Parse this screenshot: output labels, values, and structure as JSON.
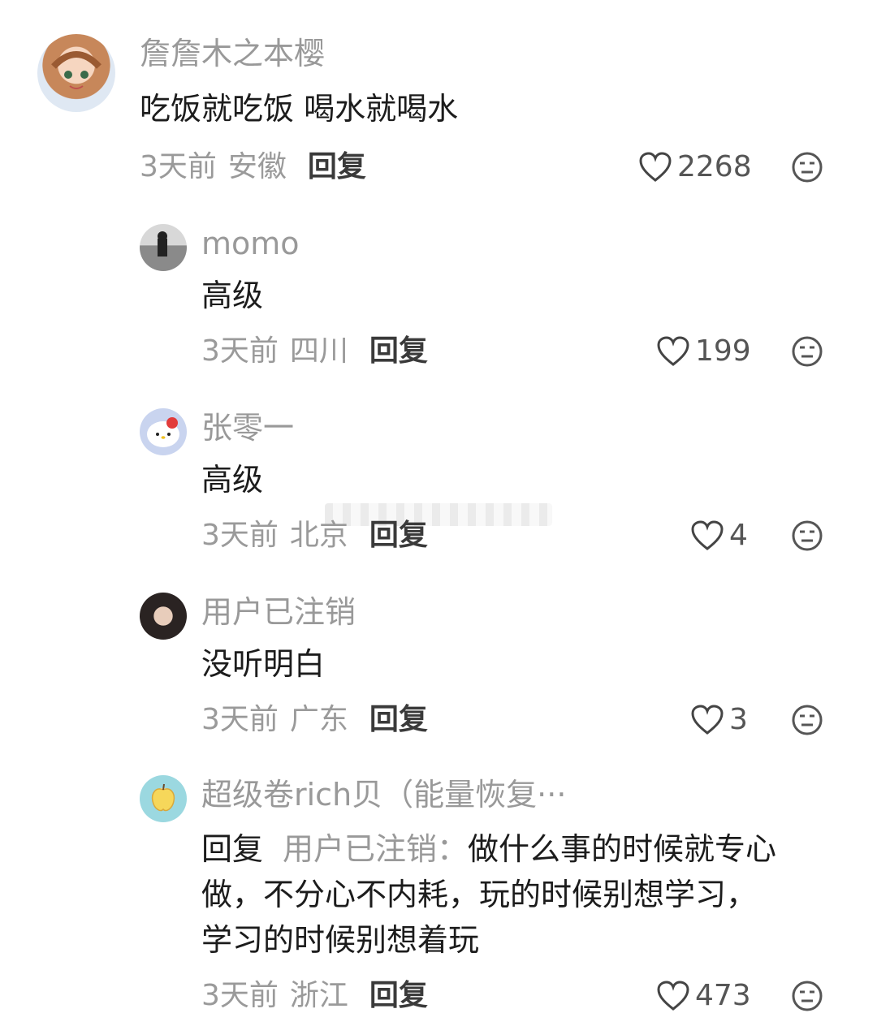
{
  "comments": [
    {
      "username": "詹詹木之本樱",
      "text": "吃饭就吃饭 喝水就喝水",
      "time": "3天前",
      "location": "安徽",
      "reply_label": "回复",
      "likes": "2268",
      "avatar_icon": "anime-girl-avatar-icon"
    },
    {
      "username": "momo",
      "text": "高级",
      "time": "3天前",
      "location": "四川",
      "reply_label": "回复",
      "likes": "199",
      "avatar_icon": "photo-avatar-icon"
    },
    {
      "username": "张零一",
      "text": "高级",
      "time": "3天前",
      "location": "北京",
      "reply_label": "回复",
      "likes": "4",
      "avatar_icon": "hello-kitty-avatar-icon"
    },
    {
      "username": "用户已注销",
      "text": "没听明白",
      "time": "3天前",
      "location": "广东",
      "reply_label": "回复",
      "likes": "3",
      "avatar_icon": "portrait-avatar-icon"
    },
    {
      "username": "超级卷rich贝（能量恢复···",
      "reply_prefix": "回复",
      "reply_target": "用户已注销：",
      "text_line1": "做什么事的时候就专心",
      "text_line2": "做，不分心不内耗，玩的时候别想学习，",
      "text_line3": "学习的时候别想着玩",
      "time": "3天前",
      "location": "浙江",
      "reply_label": "回复",
      "likes": "473",
      "avatar_icon": "apple-illustration-avatar-icon"
    }
  ],
  "colors": {
    "username": "#999999",
    "text": "#1c1c1c",
    "meta": "#9a9a9a",
    "reply": "#3a3a3a"
  }
}
